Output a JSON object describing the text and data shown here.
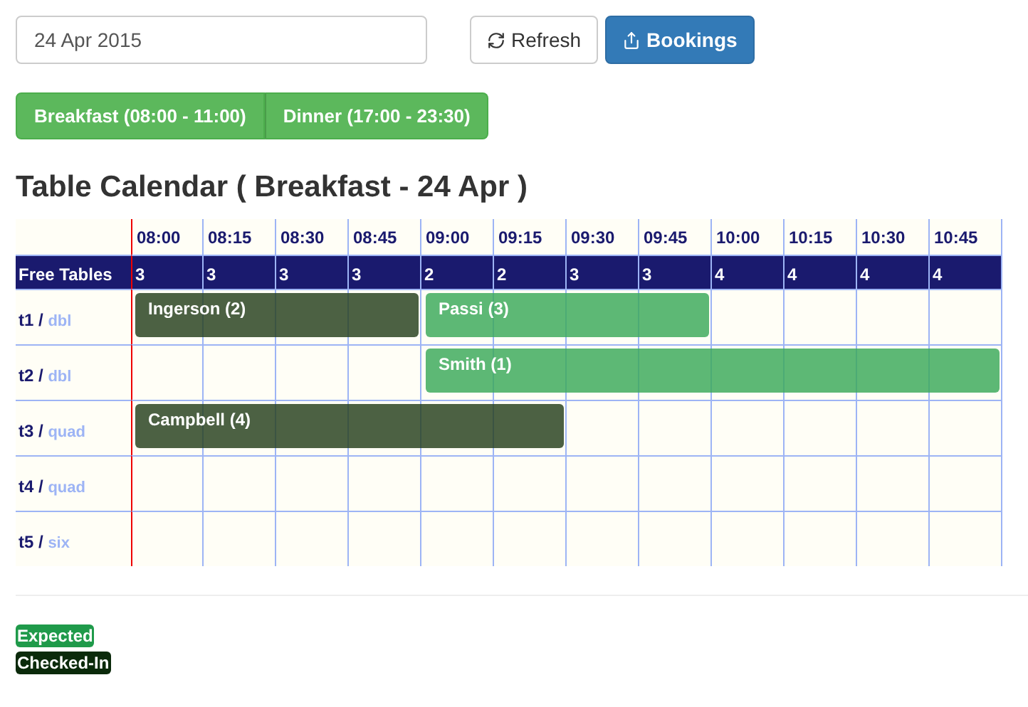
{
  "date_field": {
    "value": "24 Apr 2015"
  },
  "buttons": [
    {
      "label": "Refresh",
      "kind": "default"
    },
    {
      "label": "Bookings",
      "kind": "primary"
    }
  ],
  "meal_tabs": [
    {
      "label": "Breakfast (08:00 - 11:00)"
    },
    {
      "label": "Dinner (17:00 - 23:30)"
    }
  ],
  "title": "Table Calendar ( Breakfast - 24 Apr )",
  "calendar": {
    "columns": [
      "08:00",
      "08:15",
      "08:30",
      "08:45",
      "09:00",
      "09:15",
      "09:30",
      "09:45",
      "10:00",
      "10:15",
      "10:30",
      "10:45"
    ],
    "free_label": "Free Tables",
    "free_tables": [
      "3",
      "3",
      "3",
      "3",
      "2",
      "2",
      "3",
      "3",
      "4",
      "4",
      "4",
      "4"
    ],
    "tables": [
      {
        "name": "t1 /",
        "type": "dbl",
        "bookings": [
          {
            "guest": "Ingerson (2)",
            "kind": "checked_in"
          },
          {
            "guest": "Passi (3)",
            "kind": "expected"
          }
        ]
      },
      {
        "name": "t2 /",
        "type": "dbl",
        "bookings": [
          {
            "guest": "Smith (1)",
            "kind": "expected"
          }
        ]
      },
      {
        "name": "t3 /",
        "type": "quad",
        "bookings": [
          {
            "guest": "Campbell (4)",
            "kind": "checked_in"
          }
        ]
      },
      {
        "name": "t4 /",
        "type": "quad"
      },
      {
        "name": "t5 /",
        "type": "six"
      }
    ]
  },
  "legend": [
    {
      "label": "Expected",
      "kind": "expected"
    },
    {
      "label": "Checked-In",
      "kind": "checked_in"
    }
  ]
}
